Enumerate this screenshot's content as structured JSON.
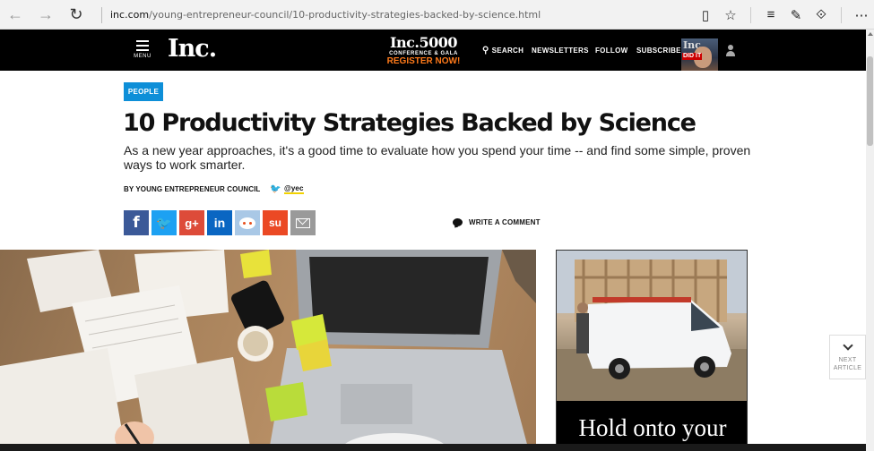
{
  "browser": {
    "url_host": "inc.com",
    "url_path": "/young-entrepreneur-council/10-productivity-strategies-backed-by-science.html"
  },
  "header": {
    "menu_label": "MENU",
    "logo": "Inc.",
    "promo": {
      "line1": "Inc.5000",
      "line2": "CONFERENCE & GALA",
      "line3": "REGISTER NOW!"
    },
    "nav": {
      "search": "SEARCH",
      "newsletters": "NEWSLETTERS",
      "follow": "FOLLOW",
      "subscribe": "SUBSCRIBE"
    },
    "magazine_cover_text": "DID IT",
    "colors": {
      "background": "#000000",
      "promo_accent": "#ff7a1a"
    }
  },
  "article": {
    "tag": "PEOPLE",
    "headline": "10 Productivity Strategies Backed by Science",
    "dek": "As a new year approaches, it's a good time to evaluate how you spend your time -- and find some simple, proven ways to work smarter.",
    "byline": {
      "author": "BY YOUNG ENTREPRENEUR COUNCIL",
      "handle": "@yec"
    },
    "share_buttons": [
      {
        "network": "facebook",
        "glyph": "f",
        "color": "#3b5998"
      },
      {
        "network": "twitter",
        "glyph": "🐦",
        "color": "#1da1f2"
      },
      {
        "network": "google-plus",
        "glyph": "g+",
        "color": "#dd4b39"
      },
      {
        "network": "linkedin",
        "glyph": "in",
        "color": "#0a66c2"
      },
      {
        "network": "reddit",
        "glyph": "",
        "color": "#a9c8e6"
      },
      {
        "network": "stumbleupon",
        "glyph": "su",
        "color": "#eb4924"
      },
      {
        "network": "email",
        "glyph": "",
        "color": "#9a9a9a"
      }
    ],
    "comment_label": "WRITE A COMMENT",
    "tag_color": "#0e8fd8"
  },
  "ad": {
    "text": "Hold onto your"
  },
  "next_article": {
    "line1": "NEXT",
    "line2": "ARTICLE"
  }
}
